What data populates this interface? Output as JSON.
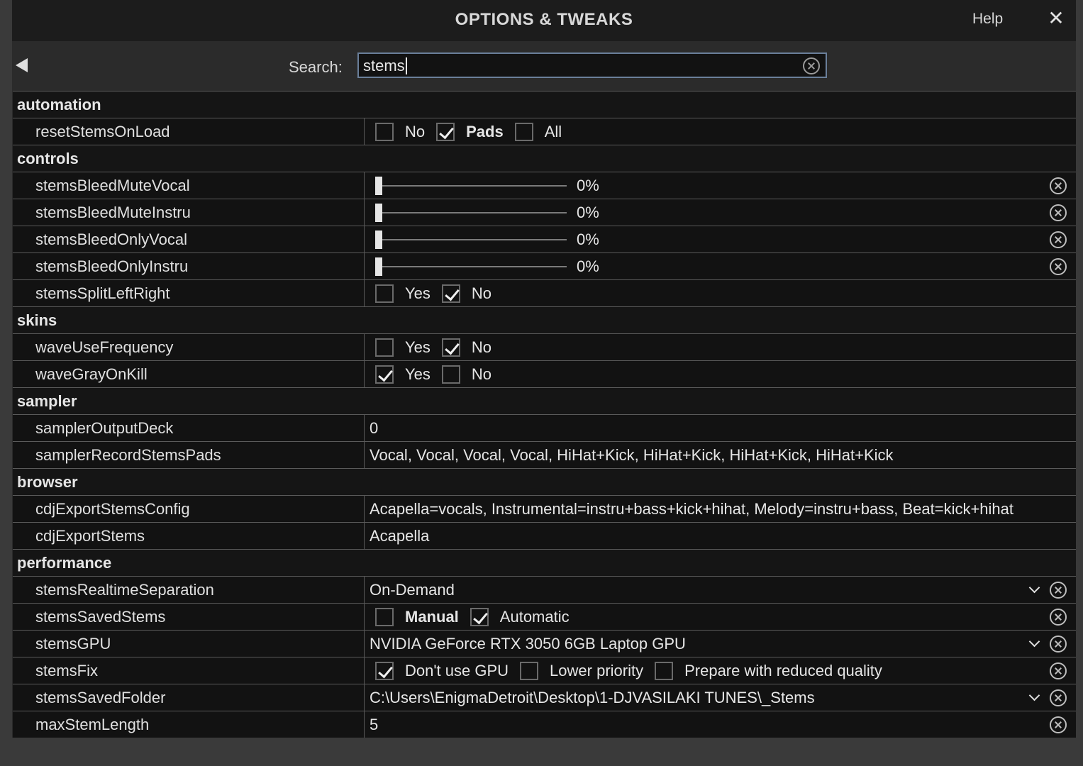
{
  "window": {
    "title": "OPTIONS & TWEAKS",
    "help_label": "Help",
    "close_glyph": "✕"
  },
  "search": {
    "label": "Search:",
    "value": "stems"
  },
  "sections": {
    "automation": "automation",
    "controls": "controls",
    "skins": "skins",
    "sampler": "sampler",
    "browser": "browser",
    "performance": "performance"
  },
  "settings": {
    "resetStemsOnLoad": {
      "name": "resetStemsOnLoad",
      "options": [
        {
          "label": "No",
          "checked": false
        },
        {
          "label": "Pads",
          "checked": true
        },
        {
          "label": "All",
          "checked": false
        }
      ]
    },
    "stemsBleedMuteVocal": {
      "name": "stemsBleedMuteVocal",
      "value": "0%",
      "level": 0
    },
    "stemsBleedMuteInstru": {
      "name": "stemsBleedMuteInstru",
      "value": "0%",
      "level": 0
    },
    "stemsBleedOnlyVocal": {
      "name": "stemsBleedOnlyVocal",
      "value": "0%",
      "level": 0
    },
    "stemsBleedOnlyInstru": {
      "name": "stemsBleedOnlyInstru",
      "value": "0%",
      "level": 0
    },
    "stemsSplitLeftRight": {
      "name": "stemsSplitLeftRight",
      "options": [
        {
          "label": "Yes",
          "checked": false
        },
        {
          "label": "No",
          "checked": true
        }
      ]
    },
    "waveUseFrequency": {
      "name": "waveUseFrequency",
      "options": [
        {
          "label": "Yes",
          "checked": false
        },
        {
          "label": "No",
          "checked": true
        }
      ]
    },
    "waveGrayOnKill": {
      "name": "waveGrayOnKill",
      "options": [
        {
          "label": "Yes",
          "checked": true
        },
        {
          "label": "No",
          "checked": false
        }
      ]
    },
    "samplerOutputDeck": {
      "name": "samplerOutputDeck",
      "value": "0"
    },
    "samplerRecordStemsPads": {
      "name": "samplerRecordStemsPads",
      "value": "Vocal, Vocal, Vocal, Vocal, HiHat+Kick, HiHat+Kick, HiHat+Kick, HiHat+Kick"
    },
    "cdjExportStemsConfig": {
      "name": "cdjExportStemsConfig",
      "value": "Acapella=vocals, Instrumental=instru+bass+kick+hihat, Melody=instru+bass, Beat=kick+hihat"
    },
    "cdjExportStems": {
      "name": "cdjExportStems",
      "value": "Acapella"
    },
    "stemsRealtimeSeparation": {
      "name": "stemsRealtimeSeparation",
      "value": "On-Demand"
    },
    "stemsSavedStems": {
      "name": "stemsSavedStems",
      "options": [
        {
          "label": "Manual",
          "checked": false
        },
        {
          "label": "Automatic",
          "checked": true
        }
      ]
    },
    "stemsGPU": {
      "name": "stemsGPU",
      "value": "NVIDIA GeForce RTX 3050 6GB Laptop GPU"
    },
    "stemsFix": {
      "name": "stemsFix",
      "options": [
        {
          "label": "Don't use GPU",
          "checked": true
        },
        {
          "label": "Lower priority",
          "checked": false
        },
        {
          "label": "Prepare with reduced quality",
          "checked": false
        }
      ]
    },
    "stemsSavedFolder": {
      "name": "stemsSavedFolder",
      "value": "C:\\Users\\EnigmaDetroit\\Desktop\\1-DJVASILAKI TUNES\\_Stems"
    },
    "maxStemLength": {
      "name": "maxStemLength",
      "value": "5"
    }
  },
  "icons": {
    "back": "back-arrow-icon",
    "clear": "clear-circle-x-icon",
    "dropdown": "chevron-down-icon",
    "check": "checkmark-icon"
  },
  "colors": {
    "window_bg": "#2b2b2b",
    "titlebar_bg": "#1c1c1c",
    "row_bg": "#121212",
    "grid_line": "#5a5a5a",
    "search_border": "#6a7f9a",
    "text": "#e6e6e6"
  }
}
